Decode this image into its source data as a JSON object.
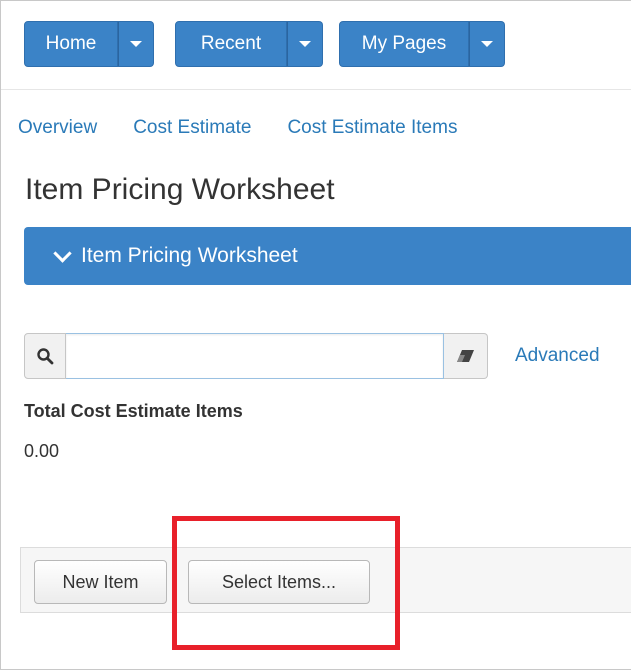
{
  "nav": {
    "home": "Home",
    "recent": "Recent",
    "my_pages": "My Pages"
  },
  "breadcrumb": {
    "items": [
      "Overview",
      "Cost Estimate",
      "Cost Estimate Items"
    ]
  },
  "page": {
    "title": "Item Pricing Worksheet",
    "panel_title": "Item Pricing Worksheet"
  },
  "search": {
    "value": "",
    "placeholder": "",
    "advanced_label": "Advanced"
  },
  "summary": {
    "total_label": "Total Cost Estimate Items",
    "total_value": "0.00"
  },
  "actions": {
    "new_item": "New Item",
    "select_items": "Select Items..."
  },
  "colors": {
    "primary": "#3b83c7",
    "link": "#2a7ab8",
    "highlight": "#e8202a"
  },
  "icons": {
    "search": "search-icon",
    "clear": "eraser-icon",
    "caret": "caret-down-icon",
    "chevron": "chevron-down-icon"
  }
}
